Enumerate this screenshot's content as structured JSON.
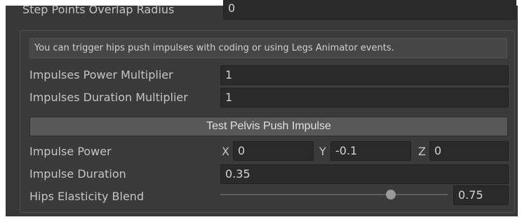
{
  "top_row": {
    "label": "Step Points Overlap Radius",
    "value": "0"
  },
  "info": {
    "text": "You can trigger hips push impulses with coding or using Legs Animator events."
  },
  "fields": {
    "power_multiplier": {
      "label": "Impulses Power Multiplier",
      "value": "1"
    },
    "duration_multiplier": {
      "label": "Impulses Duration Multiplier",
      "value": "1"
    }
  },
  "test_button": {
    "label": "Test Pelvis Push Impulse"
  },
  "impulse_power": {
    "label": "Impulse Power",
    "x_label": "X",
    "x_value": "0",
    "y_label": "Y",
    "y_value": "-0.1",
    "z_label": "Z",
    "z_value": "0"
  },
  "impulse_duration": {
    "label": "Impulse Duration",
    "value": "0.35"
  },
  "elasticity": {
    "label": "Hips Elasticity Blend",
    "value": "0.75",
    "slider_fraction": 0.75
  },
  "colors": {
    "panel_bg": "#383838",
    "field_bg": "#2a2a2a",
    "button_bg": "#585858",
    "text": "#c4c4c4"
  }
}
